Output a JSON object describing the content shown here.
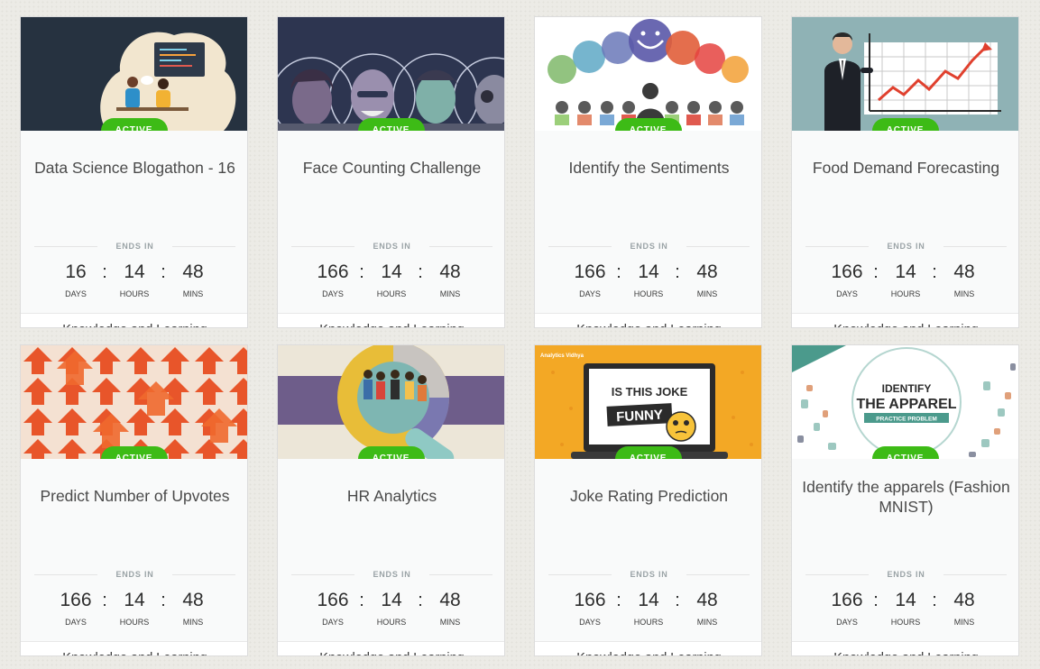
{
  "ends_label": "ENDS IN",
  "timer_labels": {
    "days": "DAYS",
    "hours": "HOURS",
    "mins": "MINS"
  },
  "status_colors": {
    "active": "#3dbb16"
  },
  "cards": [
    {
      "title": "Data Science Blogathon - 16",
      "status": "ACTIVE",
      "days": "16",
      "hours": "14",
      "mins": "48",
      "category": "Knowledge and Learning"
    },
    {
      "title": "Face Counting Challenge",
      "status": "ACTIVE",
      "days": "166",
      "hours": "14",
      "mins": "48",
      "category": "Knowledge and Learning"
    },
    {
      "title": "Identify the Sentiments",
      "status": "ACTIVE",
      "days": "166",
      "hours": "14",
      "mins": "48",
      "category": "Knowledge and Learning"
    },
    {
      "title": "Food Demand Forecasting",
      "status": "ACTIVE",
      "days": "166",
      "hours": "14",
      "mins": "48",
      "category": "Knowledge and Learning"
    },
    {
      "title": "Predict Number of Upvotes",
      "status": "ACTIVE",
      "days": "166",
      "hours": "14",
      "mins": "48",
      "category": "Knowledge and Learning"
    },
    {
      "title": "HR Analytics",
      "status": "ACTIVE",
      "days": "166",
      "hours": "14",
      "mins": "48",
      "category": "Knowledge and Learning"
    },
    {
      "title": "Joke Rating Prediction",
      "status": "ACTIVE",
      "days": "166",
      "hours": "14",
      "mins": "48",
      "category": "Knowledge and Learning",
      "banner_text": {
        "line1": "IS THIS JOKE",
        "line2": "FUNNY",
        "brand": "Analytics Vidhya"
      }
    },
    {
      "title": "Identify the apparels (Fashion MNIST)",
      "status": "ACTIVE",
      "days": "166",
      "hours": "14",
      "mins": "48",
      "category": "Knowledge and Learning",
      "banner_text": {
        "line1": "IDENTIFY",
        "line2": "THE APPAREL",
        "line3": "PRACTICE PROBLEM"
      }
    }
  ]
}
